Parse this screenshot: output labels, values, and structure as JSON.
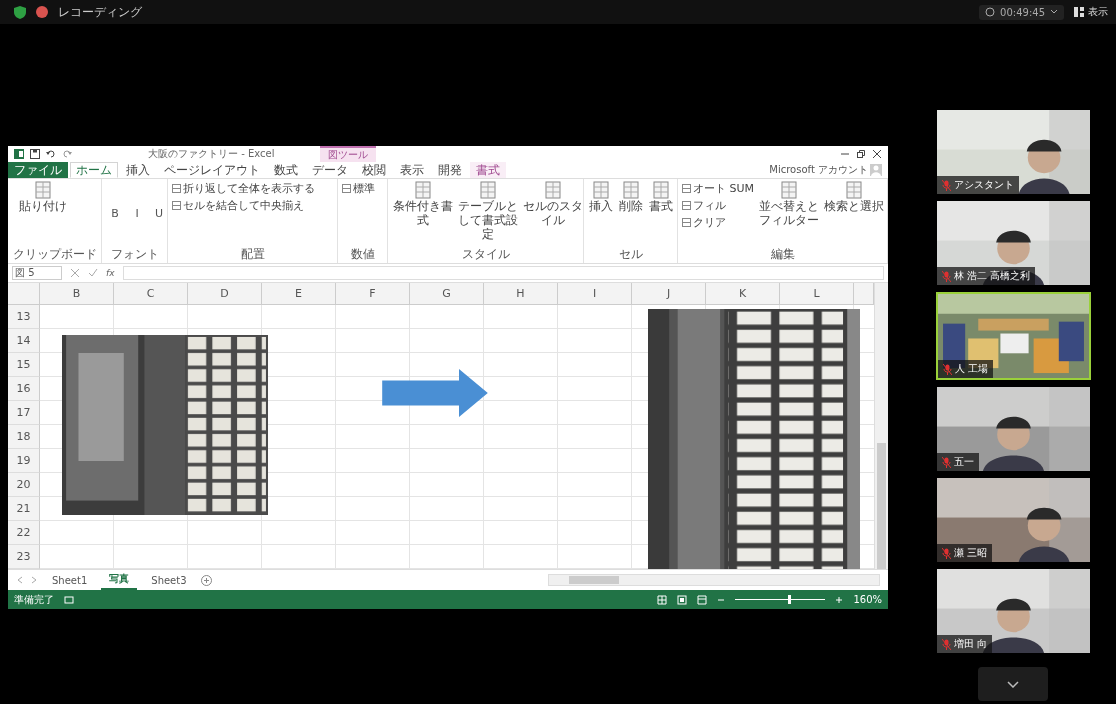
{
  "topbar": {
    "recording": "レコーディング",
    "timer": "00:49:45",
    "view": "表示"
  },
  "excel": {
    "title": "大阪のファクトリー - Excel",
    "context_tab": "図ツール",
    "account": "Microsoft アカウント",
    "tabs": [
      {
        "label": "ファイル",
        "kind": "file",
        "selected": false
      },
      {
        "label": "ホーム",
        "kind": "tab",
        "selected": true
      },
      {
        "label": "挿入",
        "kind": "tab",
        "selected": false
      },
      {
        "label": "ページレイアウト",
        "kind": "tab",
        "selected": false
      },
      {
        "label": "数式",
        "kind": "tab",
        "selected": false
      },
      {
        "label": "データ",
        "kind": "tab",
        "selected": false
      },
      {
        "label": "校閲",
        "kind": "tab",
        "selected": false
      },
      {
        "label": "表示",
        "kind": "tab",
        "selected": false
      },
      {
        "label": "開発",
        "kind": "tab",
        "selected": false
      },
      {
        "label": "書式",
        "kind": "context",
        "selected": false
      }
    ],
    "ribbon": [
      {
        "label": "クリップボード",
        "buttons": [
          {
            "label": "貼り付け",
            "kind": "large"
          }
        ]
      },
      {
        "label": "フォント",
        "buttons": [
          {
            "label": "B",
            "kind": "format"
          },
          {
            "label": "I",
            "kind": "format"
          },
          {
            "label": "U",
            "kind": "format"
          }
        ]
      },
      {
        "label": "配置",
        "buttons": [
          {
            "label": "折り返して全体を表示する",
            "kind": "small"
          },
          {
            "label": "セルを結合して中央揃え",
            "kind": "small"
          }
        ]
      },
      {
        "label": "数値",
        "buttons": [
          {
            "label": "標準",
            "kind": "small"
          }
        ]
      },
      {
        "label": "スタイル",
        "buttons": [
          {
            "label": "条件付き書式",
            "kind": "large"
          },
          {
            "label": "テーブルとして書式設定",
            "kind": "large"
          },
          {
            "label": "セルのスタイル",
            "kind": "large"
          }
        ]
      },
      {
        "label": "セル",
        "buttons": [
          {
            "label": "挿入",
            "kind": "large"
          },
          {
            "label": "削除",
            "kind": "large"
          },
          {
            "label": "書式",
            "kind": "large"
          }
        ]
      },
      {
        "label": "編集",
        "buttons": [
          {
            "label": "オート SUM",
            "kind": "small"
          },
          {
            "label": "フィル",
            "kind": "small"
          },
          {
            "label": "クリア",
            "kind": "small"
          },
          {
            "label": "並べ替えとフィルター",
            "kind": "large"
          },
          {
            "label": "検索と選択",
            "kind": "large"
          }
        ]
      }
    ],
    "name_box": "図 5",
    "function_label": "fx",
    "columns": [
      "B",
      "C",
      "D",
      "E",
      "F",
      "G",
      "H",
      "I",
      "J",
      "K",
      "L"
    ],
    "rows": [
      "13",
      "14",
      "15",
      "16",
      "17",
      "18",
      "19",
      "20",
      "21",
      "22",
      "23"
    ],
    "sheets": [
      {
        "label": "Sheet1",
        "selected": false
      },
      {
        "label": "写真",
        "selected": true
      },
      {
        "label": "Sheet3",
        "selected": false
      }
    ],
    "status": "準備完了",
    "zoom": {
      "label": "160%",
      "level": 0.6
    }
  },
  "participants": [
    {
      "name": "アシスタント",
      "muted": true,
      "active": false
    },
    {
      "name": "林 浩二 高橋之利",
      "muted": true,
      "active": false
    },
    {
      "name": "人 工場",
      "muted": true,
      "active": true
    },
    {
      "name": "五一",
      "muted": true,
      "active": false
    },
    {
      "name": "瀬 三昭",
      "muted": true,
      "active": false
    },
    {
      "name": "増田 向",
      "muted": true,
      "active": false
    }
  ]
}
